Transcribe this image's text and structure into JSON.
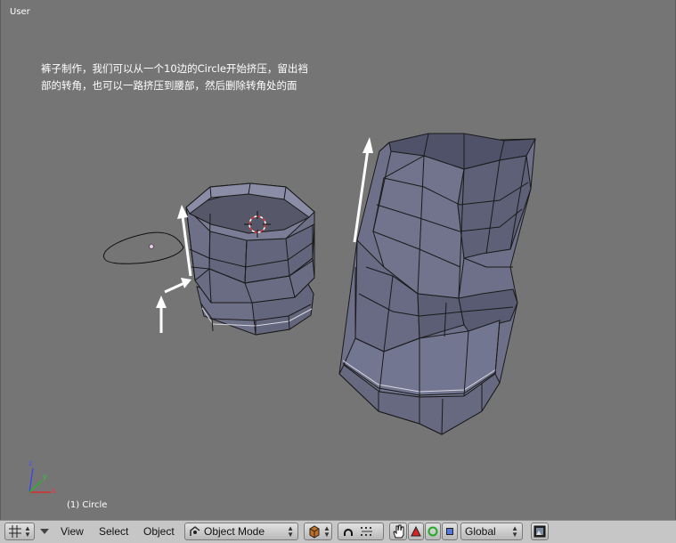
{
  "viewport": {
    "view_name": "User",
    "note_lines": [
      "裤子制作，我们可以从一个10边的Circle开始挤压，留出裆",
      "部的转角，也可以一路挤压到腰部，然后删除转角处的面"
    ],
    "object_info": "(1) Circle",
    "axis_labels": {
      "x": "x",
      "y": "y",
      "z": "z"
    }
  },
  "header": {
    "menus": [
      "View",
      "Select",
      "Object"
    ],
    "mode": "Object Mode",
    "orientation": "Global"
  },
  "icons": {
    "editor_type": "grid-icon",
    "collapse": "triangle-down-icon",
    "mode": "object-mode-icon",
    "shading": "solid-cube-icon",
    "pivot": "pivot-icon",
    "manip_toggle": "hand-icon",
    "translate": "translate-red-triangle-icon",
    "rotate": "rotate-green-ring-icon",
    "scale": "scale-blue-square-icon",
    "render": "render-image-icon"
  },
  "colors": {
    "viewport_bg": "#757575",
    "mesh_face": "#6d7088",
    "header_bg": "#c6c6c6",
    "text": "#ffffff"
  }
}
